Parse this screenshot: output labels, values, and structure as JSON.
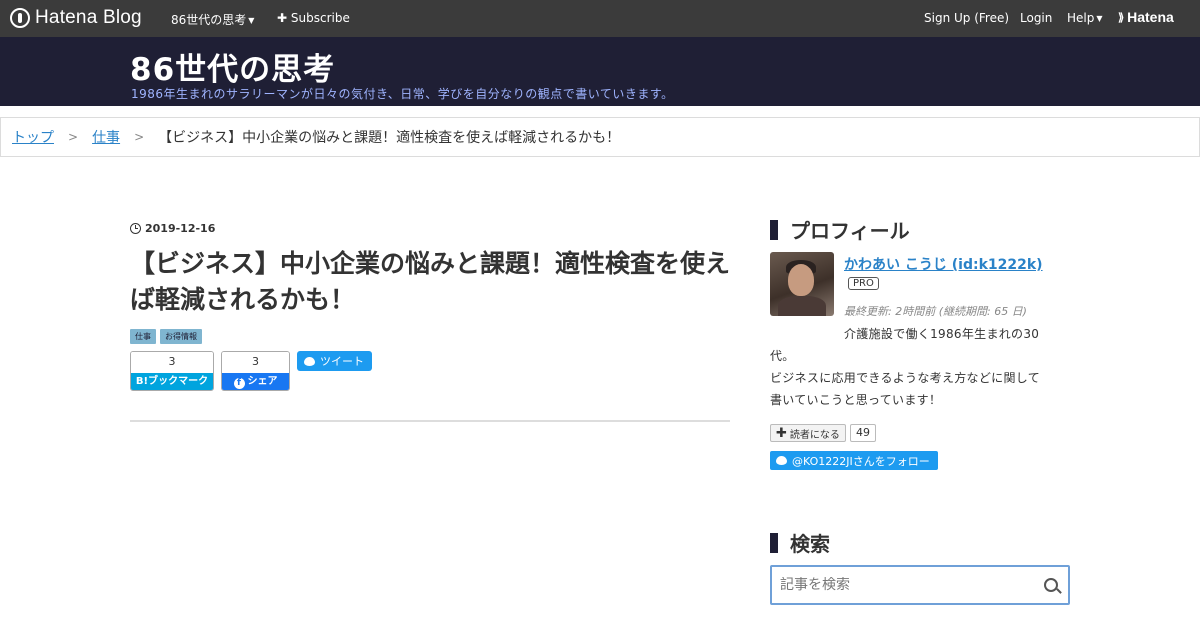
{
  "topbar": {
    "logo": "Hatena Blog",
    "blog_menu": "86世代の思考",
    "subscribe": "Subscribe",
    "signup": "Sign Up (Free)",
    "login": "Login",
    "help": "Help",
    "hatena": "Hatena"
  },
  "header": {
    "title": "86世代の思考",
    "description": "1986年生まれのサラリーマンが日々の気付き、日常、学びを自分なりの観点で書いていきます。"
  },
  "breadcrumb": {
    "items": [
      "トップ",
      "仕事"
    ],
    "current": "【ビジネス】中小企業の悩みと課題！適性検査を使えば軽減されるかも！"
  },
  "article": {
    "date": "2019-12-16",
    "title": "【ビジネス】中小企業の悩みと課題！適性検査を使えば軽減されるかも！",
    "tags": [
      "仕事",
      "お得情報"
    ],
    "hatena_bookmark": {
      "count": "3",
      "label": "B!ブックマーク"
    },
    "facebook": {
      "count": "3",
      "label": "シェア"
    },
    "tweet_label": "ツイート"
  },
  "sidebar": {
    "profile_title": "プロフィール",
    "name": "かわあい こうじ (id:k1222k)",
    "pro_badge": "PRO",
    "updated": "最終更新: 2時間前 (継続期間: 65 日)",
    "bio_line1": "介護施設で働く1986年生まれの30",
    "bio_line2": "代。",
    "bio_line3": "ビジネスに応用できるような考え方などに関して",
    "bio_line4": "書いていこうと思っています！",
    "reader_label": "読者になる",
    "reader_count": "49",
    "follow_label": "@KO1222JIさんをフォロー",
    "search_title": "検索",
    "search_placeholder": "記事を検索"
  },
  "colors": {
    "topbar": "#3b3b3b",
    "header": "#1f1f35",
    "link": "#2a82c8",
    "hatena_bookmark": "#00a4de",
    "facebook": "#1877f2",
    "twitter": "#1d9bf0"
  }
}
